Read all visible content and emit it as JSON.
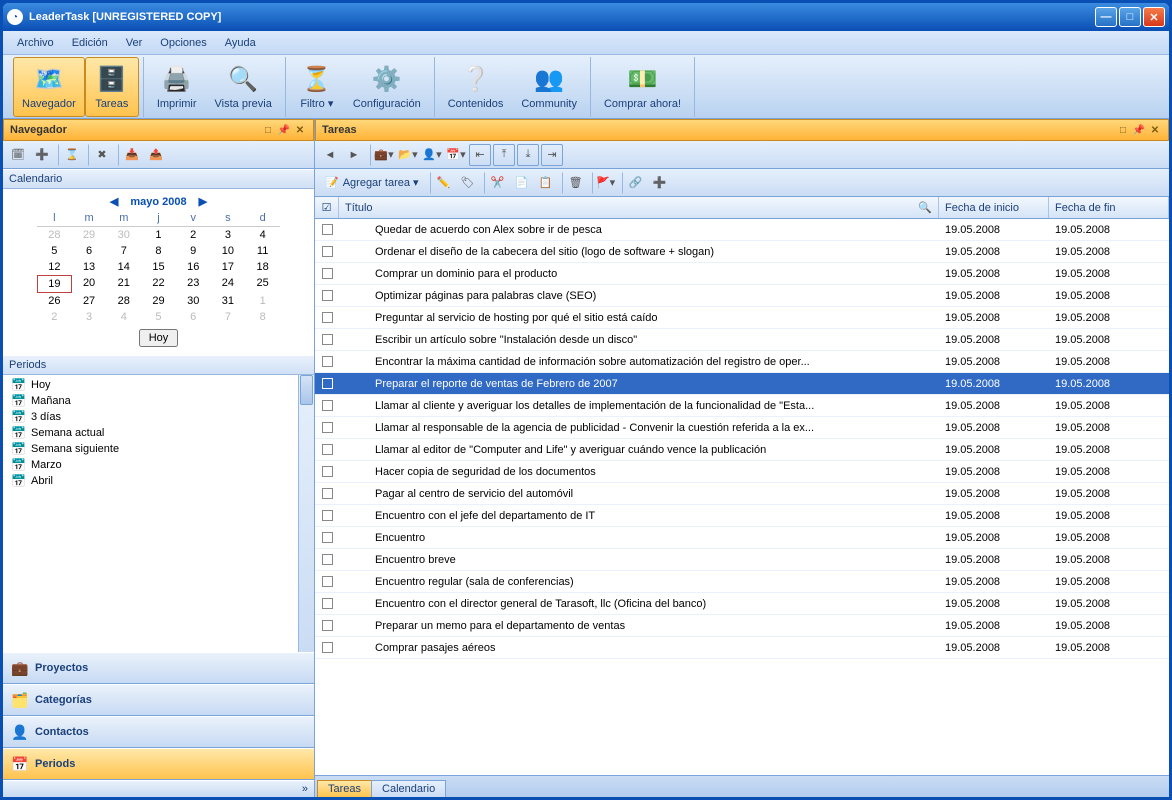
{
  "window": {
    "title": "LeaderTask [UNREGISTERED COPY]"
  },
  "menu": [
    "Archivo",
    "Edición",
    "Ver",
    "Opciones",
    "Ayuda"
  ],
  "toolbar": [
    {
      "label": "Navegador",
      "icon": "🗺️",
      "active": true
    },
    {
      "label": "Tareas",
      "icon": "🗄️",
      "active": true
    },
    {
      "label": "Imprimir",
      "icon": "🖨️"
    },
    {
      "label": "Vista previa",
      "icon": "🔍"
    },
    {
      "label": "Filtro ▾",
      "icon": "⏳"
    },
    {
      "label": "Configuración",
      "icon": "⚙️"
    },
    {
      "label": "Contenidos",
      "icon": "❔"
    },
    {
      "label": "Community",
      "icon": "👥"
    },
    {
      "label": "Comprar ahora!",
      "icon": "💵"
    }
  ],
  "left": {
    "title": "Navegador",
    "calendar": {
      "label": "Calendario",
      "month": "mayo 2008",
      "dow": [
        "l",
        "m",
        "m",
        "j",
        "v",
        "s",
        "d"
      ],
      "prev": [
        28,
        29,
        30
      ],
      "days": 31,
      "today": 19,
      "next": [
        1,
        2,
        3,
        4,
        5,
        6,
        7,
        8
      ],
      "hoy": "Hoy"
    },
    "periods": {
      "label": "Periods",
      "items": [
        "Hoy",
        "Mañana",
        "3 días",
        "Semana actual",
        "Semana siguiente",
        "Marzo",
        "Abril"
      ]
    },
    "nav": [
      {
        "label": "Proyectos",
        "icon": "💼"
      },
      {
        "label": "Categorías",
        "icon": "🗂️"
      },
      {
        "label": "Contactos",
        "icon": "👤"
      },
      {
        "label": "Periods",
        "icon": "📅",
        "selected": true
      }
    ]
  },
  "right": {
    "title": "Tareas",
    "addtask": "Agregar tarea ▾",
    "columns": {
      "chk": "☑",
      "title": "Título",
      "start": "Fecha de inicio",
      "end": "Fecha de fin"
    },
    "rows": [
      {
        "t": "Quedar de acuerdo con Alex sobre ir de pesca",
        "s": "19.05.2008",
        "e": "19.05.2008"
      },
      {
        "t": "Ordenar el diseño de la cabecera del sitio (logo de software + slogan)",
        "s": "19.05.2008",
        "e": "19.05.2008"
      },
      {
        "t": "Comprar un dominio para el producto",
        "s": "19.05.2008",
        "e": "19.05.2008"
      },
      {
        "t": "Optimizar páginas para palabras clave (SEO)",
        "s": "19.05.2008",
        "e": "19.05.2008"
      },
      {
        "t": "Preguntar al servicio de hosting por qué el sitio está caído",
        "s": "19.05.2008",
        "e": "19.05.2008"
      },
      {
        "t": "Escribir un artículo sobre \"Instalación desde un disco\"",
        "s": "19.05.2008",
        "e": "19.05.2008"
      },
      {
        "t": "Encontrar la máxima cantidad de información sobre automatización del registro de oper...",
        "s": "19.05.2008",
        "e": "19.05.2008"
      },
      {
        "t": "Preparar el reporte de ventas de Febrero de 2007",
        "s": "19.05.2008",
        "e": "19.05.2008",
        "sel": true
      },
      {
        "t": "Llamar al cliente y averiguar los detalles de implementación de la funcionalidad de \"Esta...",
        "s": "19.05.2008",
        "e": "19.05.2008"
      },
      {
        "t": "Llamar al responsable de la agencia de publicidad - Convenir la cuestión referida a la ex...",
        "s": "19.05.2008",
        "e": "19.05.2008"
      },
      {
        "t": "Llamar al editor de \"Computer and Life\" y averiguar cuándo vence la publicación",
        "s": "19.05.2008",
        "e": "19.05.2008"
      },
      {
        "t": "Hacer copia de seguridad de los documentos",
        "s": "19.05.2008",
        "e": "19.05.2008"
      },
      {
        "t": "Pagar al centro de servicio del automóvil",
        "s": "19.05.2008",
        "e": "19.05.2008"
      },
      {
        "t": "Encuentro con el jefe del departamento de IT",
        "s": "19.05.2008",
        "e": "19.05.2008"
      },
      {
        "t": "Encuentro",
        "s": "19.05.2008",
        "e": "19.05.2008"
      },
      {
        "t": "Encuentro breve",
        "s": "19.05.2008",
        "e": "19.05.2008"
      },
      {
        "t": "Encuentro regular (sala de conferencias)",
        "s": "19.05.2008",
        "e": "19.05.2008"
      },
      {
        "t": "Encuentro con el director general de Tarasoft, llc (Oficina del banco)",
        "s": "19.05.2008",
        "e": "19.05.2008"
      },
      {
        "t": "Preparar un memo para el departamento de ventas",
        "s": "19.05.2008",
        "e": "19.05.2008"
      },
      {
        "t": "Comprar pasajes aéreos",
        "s": "19.05.2008",
        "e": "19.05.2008"
      }
    ],
    "tabs": [
      {
        "label": "Tareas",
        "active": true
      },
      {
        "label": "Calendario"
      }
    ]
  }
}
